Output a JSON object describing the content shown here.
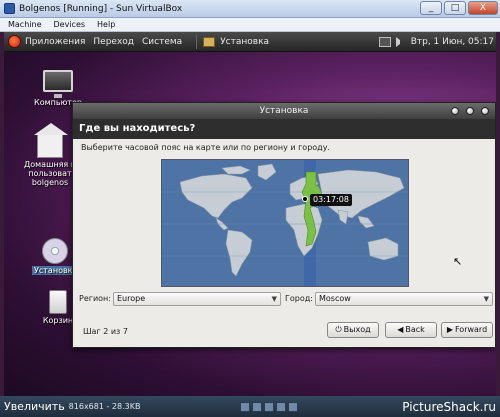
{
  "host": {
    "title": "Bolgenos [Running] - Sun VirtualBox",
    "menu": [
      "Machine",
      "Devices",
      "Help"
    ],
    "window_buttons": [
      "_",
      "□",
      "X"
    ]
  },
  "panel": {
    "menus": [
      "Приложения",
      "Переход",
      "Система"
    ],
    "task": "Установка",
    "clock": "Втр, 1 Июн, 05:17"
  },
  "desktop": {
    "icons": [
      {
        "name": "computer",
        "label": "Компьютер"
      },
      {
        "name": "home",
        "label1": "Домашняя п",
        "label2": "пользоват",
        "label3": "bolgenos"
      },
      {
        "name": "installer",
        "label": "Установка"
      },
      {
        "name": "trash",
        "label": "Корзин"
      }
    ]
  },
  "installer": {
    "window_title": "Установка",
    "heading": "Где вы находитесь?",
    "subtitle": "Выберите часовой пояс на карте или по региону и городу.",
    "time_tooltip": "03:17:08",
    "region_label": "Регион:",
    "region_value": "Europe",
    "city_label": "Город:",
    "city_value": "Moscow",
    "step": "Шаг 2 из 7",
    "quit_label": "Выход",
    "back_label": "Back",
    "forward_label": "Forward"
  },
  "bottom": {
    "enlarge": "Увеличить",
    "info": "816x681 - 28.3KB",
    "brand": "PictureShack.ru"
  },
  "colors": {
    "map_ocean": "#4e74a6",
    "map_land": "#c6cdd5",
    "timezone_highlight": "#7bc143",
    "wallpaper": "#8a3d8c"
  }
}
